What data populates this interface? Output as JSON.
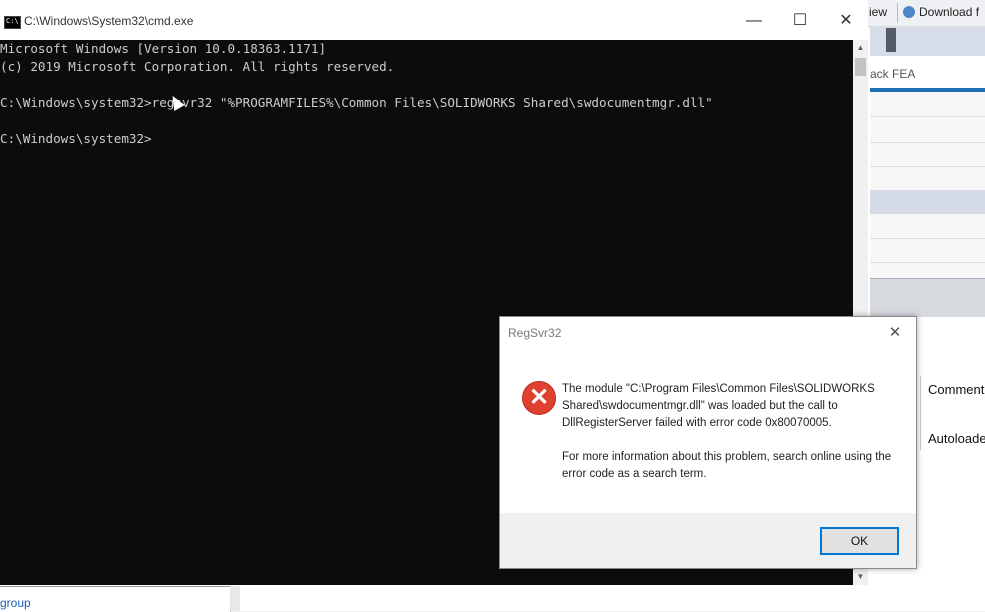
{
  "background_app": {
    "toolbar_view": "iew",
    "toolbar_download": "Download f",
    "fea_label": "ack FEA",
    "comment_header": "Comment",
    "autoloader_cell": "Autoloader",
    "bottom_left_text": "group"
  },
  "cmd": {
    "title": "C:\\Windows\\System32\\cmd.exe",
    "icon_label": "C:\\",
    "lines": [
      "Microsoft Windows [Version 10.0.18363.1171]",
      "(c) 2019 Microsoft Corporation. All rights reserved.",
      "",
      "C:\\Windows\\system32>regsvr32 \"%PROGRAMFILES%\\Common Files\\SOLIDWORKS Shared\\swdocumentmgr.dll\"",
      "",
      "C:\\Windows\\system32>"
    ],
    "minimize": "—",
    "maximize": "☐",
    "close": "✕"
  },
  "dialog": {
    "title": "RegSvr32",
    "close": "✕",
    "icon": "error-icon",
    "message_lines": [
      "The module \"C:\\Program Files\\Common Files\\SOLIDWORKS",
      "Shared\\swdocumentmgr.dll\" was loaded but the call to",
      "DllRegisterServer failed with error code 0x80070005."
    ],
    "info_lines": [
      "For more information about this problem, search online using the",
      "error code as a search term."
    ],
    "ok_label": "OK"
  },
  "colors": {
    "console_bg": "#0c0c0c",
    "console_text": "#cccccc",
    "error_red": "#e0402f",
    "focus_blue": "#0078d7"
  }
}
